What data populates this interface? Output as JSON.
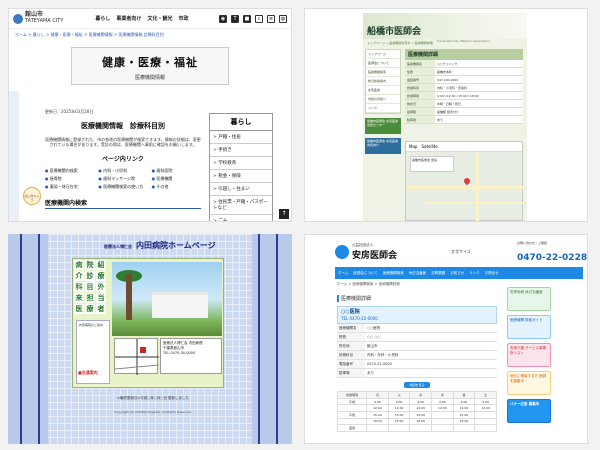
{
  "p1": {
    "logo_city": "館山市",
    "logo_sub": "TATEYAMA CITY",
    "nav": [
      "暮らし",
      "事業者向け",
      "文化・観光",
      "市政"
    ],
    "breadcrumb": "ホーム > 暮らし > 健康・医療・福祉 > 医療機関情報 > 医療機関情報 診療科目別",
    "hero_title": "健康・医療・福祉",
    "hero_sub": "医療機関情報",
    "updated": "更新日：2025年03月28日",
    "page_title": "医療機関情報　診療科目別",
    "lead": "医療機関情報に登録された、市の各地の医療機関が検索できます。情報の詳細は、変更されている場合があります。受診の際は、医療機関へ事前に確認をお願いします。",
    "links_heading": "ページ内リンク",
    "links": [
      "医療機関内検索",
      "内科・小児科",
      "歯科医院",
      "接骨院",
      "歯科マッサージ院",
      "医療機関",
      "薬局・休日在宅",
      "医療機関検索の使い方",
      "その他"
    ],
    "section_heading": "医療機関内検索",
    "character": "館山市キャラ",
    "side_heading": "暮らし",
    "side_items": [
      "戸籍・住居",
      "手続き",
      "学校教育",
      "税金・保険",
      "引越し・住まい",
      "住民票・戸籍・パスポートなど",
      "ごみ"
    ],
    "gotop": "↑"
  },
  "p2": {
    "title": "船橋市医師会",
    "subtitle": "Funabashi City Medical Association",
    "breadcrumb": "トップページ > 医療機関を探す > 医療機関詳細",
    "nav": [
      "トップページ",
      "医師会について",
      "医療機関検索",
      "休日診療案内",
      "在宅医療",
      "市民の皆様へ",
      "リンク"
    ],
    "banners": [
      "船橋市医師会 在宅医療支援センター",
      "船橋市医師会 在宅医療 市民向け"
    ],
    "section_title": "医療機関詳細",
    "rows": [
      {
        "k": "医療機関名",
        "v": "○○クリニック"
      },
      {
        "k": "住所",
        "v": "船橋市本町"
      },
      {
        "k": "電話番号",
        "v": "047-000-0000"
      },
      {
        "k": "診療科目",
        "v": "内科・小児科・皮膚科"
      },
      {
        "k": "診療時間",
        "v": "9:00〜12:00 / 15:00〜18:00"
      },
      {
        "k": "休診日",
        "v": "木曜・日曜・祝日"
      },
      {
        "k": "最寄駅",
        "v": "船橋駅 徒歩5分"
      },
      {
        "k": "駐車場",
        "v": "あり"
      }
    ],
    "map_tabs": [
      "Map",
      "Satellite"
    ],
    "map_card": "船橋市医師会 会館"
  },
  "p3": {
    "title_prefix": "医療法人博仁会",
    "title": "内田病院ホームページ",
    "kanji": [
      "病",
      "院",
      "紹",
      "介",
      "診",
      "療",
      "科",
      "目",
      "外",
      "来",
      "担",
      "当",
      "医",
      "療",
      "者",
      "の",
      "方",
      "へ"
    ],
    "left_text": "内田病院のご案内",
    "info_lines": [
      "医療法人博仁会 内田病院",
      "千葉県館山市",
      "TEL 0470-00-0000"
    ],
    "links": "■交通案内",
    "update_text": "<最終更新日>平成○年○月○日 更新しました",
    "copyright": "Copyright (C) UCHIDA Hospital. All Rights Reserved."
  },
  "p4": {
    "org_type": "公益社団法人",
    "name": "安房医師会",
    "small_links": "文字サイズ",
    "tel_label": "お問い合わせ・ご相談",
    "tel": "0470-22-0228",
    "nav": [
      "ホーム",
      "医師会について",
      "医療機関検索",
      "休日当番医",
      "訪問看護",
      "お知らせ",
      "リンク",
      "お問合せ"
    ],
    "breadcrumb": "ホーム > 医療機関検索 > 医療機関詳細",
    "section": "医療機関詳細",
    "card_title": "○○医院",
    "card_tel": "TEL 0470-22-0000",
    "rows": [
      {
        "k": "医療機関名",
        "v": "○○医院"
      },
      {
        "k": "院長",
        "v": "○○ ○○"
      },
      {
        "k": "所在地",
        "v": "館山市"
      },
      {
        "k": "診療科目",
        "v": "内科・外科・小児科"
      },
      {
        "k": "電話番号",
        "v": "0470-22-0000"
      },
      {
        "k": "駐車場",
        "v": "あり"
      }
    ],
    "button": "地図を見る",
    "table_head": [
      "診療時間",
      "月",
      "火",
      "水",
      "木",
      "金",
      "土"
    ],
    "table_rows": [
      [
        "午前",
        "9:00",
        "9:00",
        "9:00",
        "9:00",
        "9:00",
        "9:00"
      ],
      [
        "",
        "12:00",
        "12:00",
        "12:00",
        "12:00",
        "12:00",
        "12:00"
      ],
      [
        "午後",
        "15:00",
        "15:00",
        "15:00",
        "",
        "15:00",
        ""
      ],
      [
        "",
        "18:00",
        "18:00",
        "18:00",
        "",
        "18:00",
        ""
      ],
      [
        "夜間",
        "",
        "",
        "",
        "",
        "",
        ""
      ]
    ],
    "side_banners": [
      "安房地域 休日当番医",
      "医療機関 検索ガイド",
      "安房介護 サービス事業所リスト",
      "地元に帰省する方 医師を募集中",
      "バナー広告 募集中"
    ]
  }
}
